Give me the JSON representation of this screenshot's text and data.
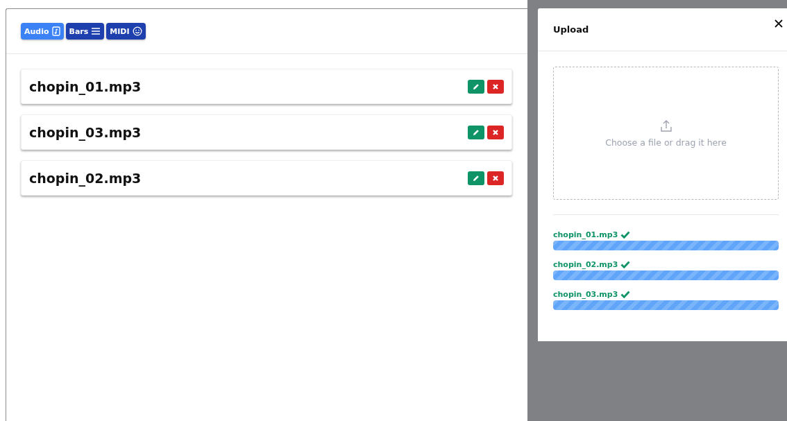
{
  "tabs": [
    {
      "label": "Audio",
      "selected": true
    },
    {
      "label": "Bars",
      "selected": false
    },
    {
      "label": "MIDI",
      "selected": false
    }
  ],
  "files": [
    {
      "name": "chopin_01.mp3"
    },
    {
      "name": "chopin_03.mp3"
    },
    {
      "name": "chopin_02.mp3"
    }
  ],
  "upload": {
    "title": "Upload",
    "dropzone_text": "Choose a file or drag it here",
    "items": [
      {
        "name": "chopin_01.mp3",
        "done": true,
        "level": 1
      },
      {
        "name": "chopin_02.mp3",
        "done": true,
        "level": 1
      },
      {
        "name": "chopin_03.mp3",
        "done": true,
        "level": 1
      }
    ]
  }
}
